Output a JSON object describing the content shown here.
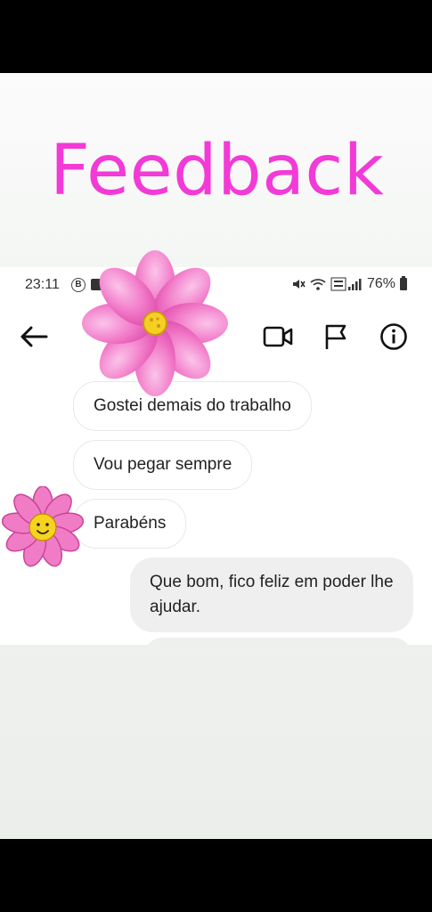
{
  "header_title": "Feedback",
  "status_bar": {
    "time": "23:11",
    "left_icon": "B",
    "battery": "76%"
  },
  "chat": {
    "incoming": [
      "Gostei demais do trabalho",
      "Vou pegar sempre",
      "Parabéns"
    ],
    "outgoing": [
      "Que bom, fico feliz em poder lhe ajudar."
    ]
  },
  "colors": {
    "title": "#f23ad7",
    "flower_petal": "#f07cc6",
    "flower_center": "#f5cf22"
  },
  "icons": [
    "back-arrow-icon",
    "video-call-icon",
    "flag-icon",
    "info-icon",
    "pink-flower-sticker",
    "smiley-flower-sticker"
  ]
}
